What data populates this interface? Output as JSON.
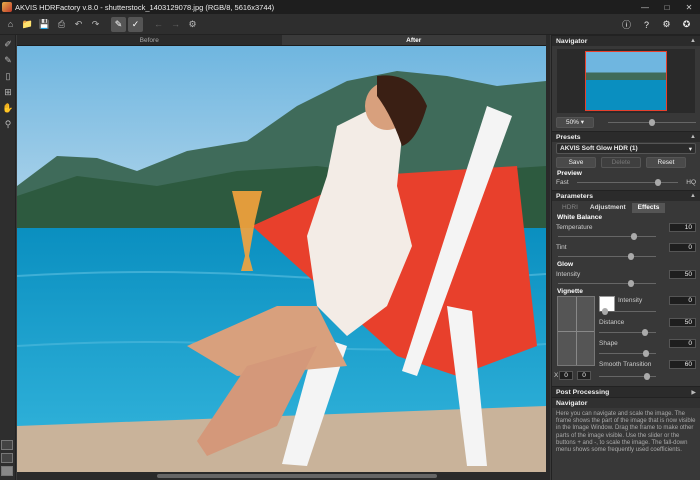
{
  "window": {
    "title": "AKVIS HDRFactory v.8.0 - shutterstock_1403129078.jpg (RGB/8, 5616x3744)"
  },
  "view": {
    "tab_before": "Before",
    "tab_after": "After"
  },
  "navigator": {
    "title": "Navigator",
    "zoom": "50%"
  },
  "presets": {
    "title": "Presets",
    "selected": "AKVIS Soft Glow HDR (1)",
    "save": "Save",
    "delete": "Delete",
    "reset": "Reset"
  },
  "preview": {
    "title": "Preview",
    "fast": "Fast",
    "hq": "HQ",
    "level": 0.8
  },
  "parameters": {
    "title": "Parameters",
    "tabs": {
      "hdri": "HDRI",
      "adjustment": "Adjustment",
      "effects": "Effects"
    },
    "white_balance": {
      "title": "White Balance",
      "temperature_label": "Temperature",
      "temperature": "10",
      "tint_label": "Tint",
      "tint": "0"
    },
    "glow": {
      "title": "Glow",
      "intensity_label": "Intensity",
      "intensity": "50"
    },
    "vignette": {
      "title": "Vignette",
      "intensity_label": "Intensity",
      "intensity": "0",
      "distance_label": "Distance",
      "distance": "50",
      "shape_label": "Shape",
      "shape": "0",
      "smooth_label": "Smooth Transition",
      "smooth": "60",
      "x_label": "X",
      "x": "0",
      "y": "0"
    }
  },
  "post_processing": {
    "title": "Post Processing"
  },
  "help": {
    "title": "Navigator",
    "text": "Here you can navigate and scale the image. The frame shows the part of the image that is now visible in the Image Window. Drag the frame to make other parts of the image visible. Use the slider or the buttons + and -, to scale the image. The fall-down menu shows some frequently used coefficients."
  },
  "colors": {
    "accent": "#e8402c",
    "panel": "#383838",
    "header": "#2b2b2b"
  }
}
